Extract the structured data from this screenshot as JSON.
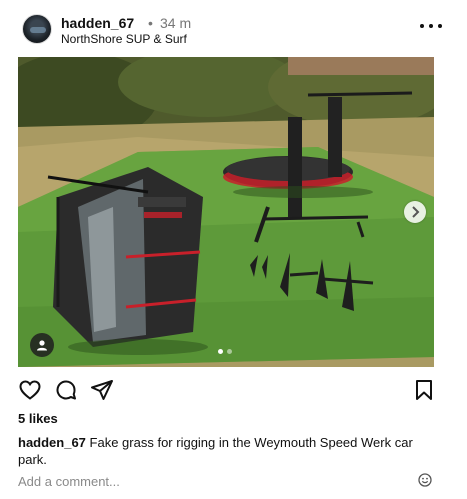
{
  "post": {
    "username": "hadden_67",
    "separator": "•",
    "time": "34 m",
    "location": "NorthShore SUP & Surf",
    "likes": "5 likes",
    "caption_user": "hadden_67",
    "caption_text": "Fake grass for rigging in the Weymouth Speed Werk car park.",
    "comment_placeholder": "Add a comment...",
    "carousel": {
      "total": 2,
      "current": 1
    }
  },
  "icons": {
    "avatar": "profile-photo",
    "more": "more-options-icon",
    "next": "chevron-right-icon",
    "tag": "user-tag-icon",
    "like": "heart-icon",
    "comment": "comment-bubble-icon",
    "share": "send-icon",
    "save": "bookmark-icon",
    "emoji": "emoji-icon"
  },
  "colors": {
    "text": "#111111",
    "muted": "#8a8a8a",
    "grass": "#5e9a3a",
    "board": "#2b2b2b",
    "accent_red": "#c8202a"
  }
}
